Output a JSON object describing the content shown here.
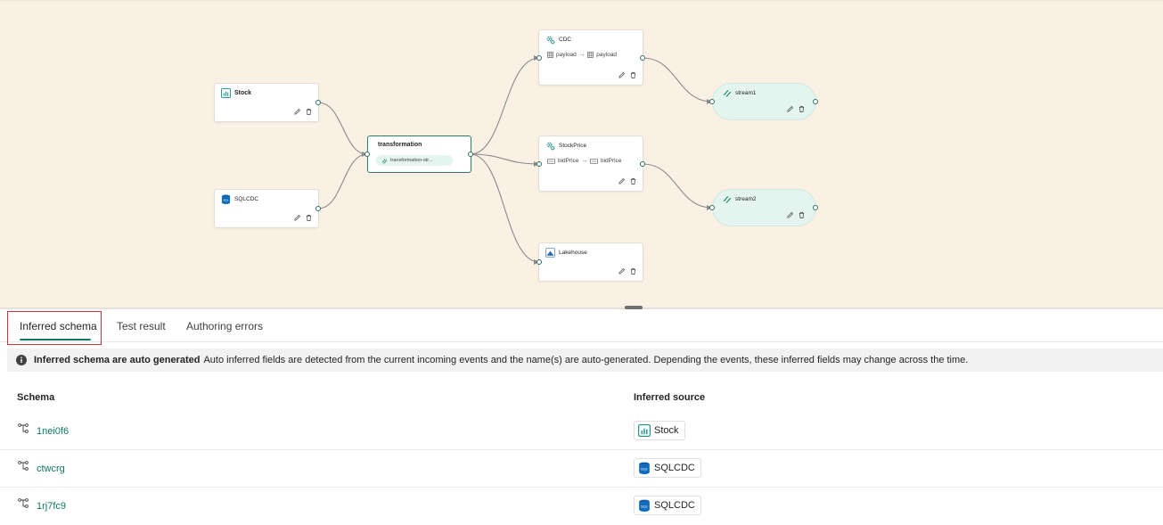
{
  "canvas": {
    "nodes": {
      "stock": {
        "title": "Stock",
        "icon": "bar-chart-icon"
      },
      "sqlcdc": {
        "title": "SQLCDC",
        "icon": "sql-database-icon"
      },
      "transformation": {
        "title": "transformation",
        "chip": "transformation-str..."
      },
      "cdc": {
        "title": "CDC",
        "icon": "gear-icon",
        "from_field": "payload",
        "to_field": "payload"
      },
      "stockprice": {
        "title": "StockPrice",
        "icon": "gear-icon",
        "from_field": "bidPrice",
        "to_field": "bidPrice"
      },
      "lakehouse": {
        "title": "Lakehouse",
        "icon": "lakehouse-icon"
      },
      "stream1": {
        "title": "stream1",
        "icon": "stream-icon"
      },
      "stream2": {
        "title": "stream2",
        "icon": "stream-icon"
      }
    }
  },
  "tabs": [
    {
      "label": "Inferred schema",
      "active": true
    },
    {
      "label": "Test result",
      "active": false
    },
    {
      "label": "Authoring errors",
      "active": false
    }
  ],
  "info": {
    "bold": "Inferred schema are auto generated",
    "text": "Auto inferred fields are detected from the current incoming events and the name(s) are auto-generated. Depending the events, these inferred fields may change across the time."
  },
  "table": {
    "headers": {
      "schema": "Schema",
      "source": "Inferred source"
    },
    "rows": [
      {
        "schema": "1nei0f6",
        "source": "Stock",
        "source_icon": "bar-chart-icon"
      },
      {
        "schema": "ctwcrg",
        "source": "SQLCDC",
        "source_icon": "sql-database-icon"
      },
      {
        "schema": "1rj7fc9",
        "source": "SQLCDC",
        "source_icon": "sql-database-icon"
      }
    ]
  },
  "colors": {
    "canvas_bg": "#faf1e4",
    "accent": "#117865",
    "stream_bg": "#e3f5ee",
    "highlight": "#d13438"
  }
}
